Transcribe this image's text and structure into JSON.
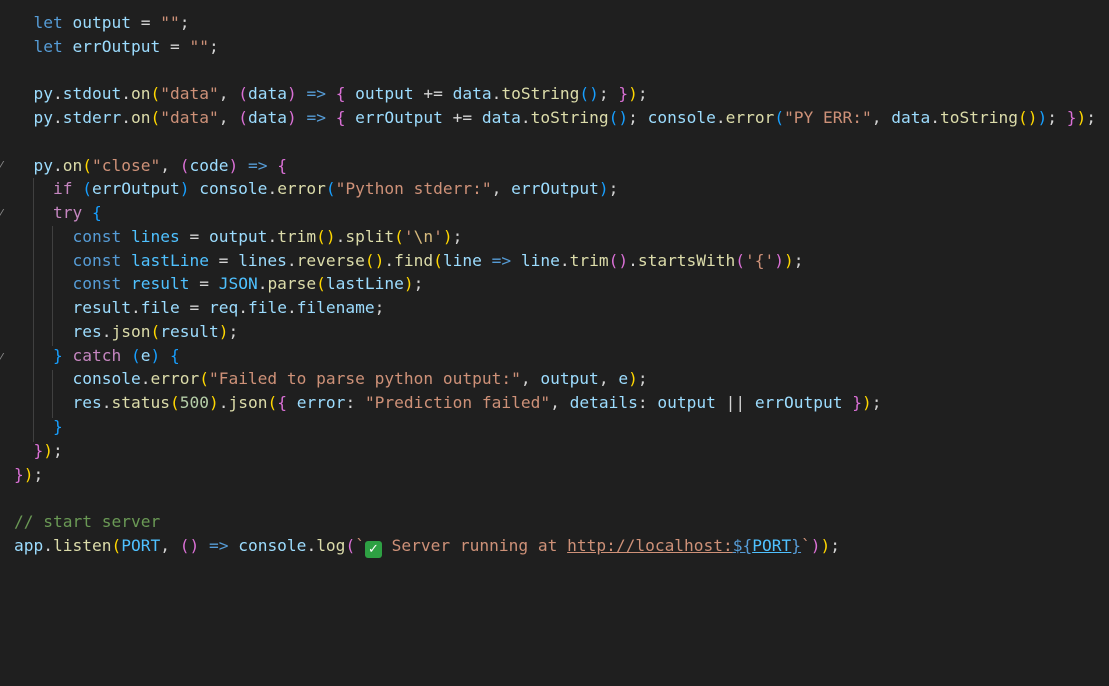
{
  "lines": {
    "l1": {
      "t1": "let",
      "t2": "output",
      "t3": "=",
      "t4": "\"\"",
      "t5": ";"
    },
    "l2": {
      "t1": "let",
      "t2": "errOutput",
      "t3": "=",
      "t4": "\"\"",
      "t5": ";"
    },
    "l4": {
      "t1": "py",
      "t2": ".",
      "t3": "stdout",
      "t4": ".",
      "t5": "on",
      "t6": "(",
      "t7": "\"data\"",
      "t8": ", ",
      "t9": "(",
      "t10": "data",
      "t11": ")",
      "t12": " => ",
      "t13": "{",
      "t14": " output ",
      "t15": "+=",
      "t16": " data",
      "t17": ".",
      "t18": "toString",
      "t19": "()",
      "t20": "; ",
      "t21": "}",
      "t22": ")",
      "t23": ";"
    },
    "l5": {
      "t1": "py",
      "t2": ".",
      "t3": "stderr",
      "t4": ".",
      "t5": "on",
      "t6": "(",
      "t7": "\"data\"",
      "t8": ", ",
      "t9": "(",
      "t10": "data",
      "t11": ")",
      "t12": " => ",
      "t13": "{",
      "t14": " errOutput ",
      "t15": "+=",
      "t16": " data",
      "t17": ".",
      "t18": "toString",
      "t19": "()",
      "t20": "; ",
      "t21": "console",
      "t22": ".",
      "t23": "error",
      "t24": "(",
      "t25": "\"PY ERR:\"",
      "t26": ", ",
      "t27": "data",
      "t28": ".",
      "t29": "toString",
      "t30": "()",
      "t31": ")",
      "t32": "; ",
      "t33": "}",
      "t34": ")",
      "t35": ";"
    },
    "l7": {
      "t1": "py",
      "t2": ".",
      "t3": "on",
      "t4": "(",
      "t5": "\"close\"",
      "t6": ", ",
      "t7": "(",
      "t8": "code",
      "t9": ")",
      "t10": " => ",
      "t11": "{"
    },
    "l8": {
      "t1": "if",
      "t2": " (",
      "t3": "errOutput",
      "t4": ") ",
      "t5": "console",
      "t6": ".",
      "t7": "error",
      "t8": "(",
      "t9": "\"Python stderr:\"",
      "t10": ", ",
      "t11": "errOutput",
      "t12": ")",
      "t13": ";"
    },
    "l9": {
      "t1": "try",
      "t2": " ",
      "t3": "{"
    },
    "l10": {
      "t1": "const",
      "t2": " ",
      "t3": "lines",
      "t4": " = ",
      "t5": "output",
      "t6": ".",
      "t7": "trim",
      "t8": "()",
      "t9": ".",
      "t10": "split",
      "t11": "(",
      "t12": "'",
      "t13": "\\n",
      "t14": "'",
      "t15": ")",
      "t16": ";"
    },
    "l11": {
      "t1": "const",
      "t2": " ",
      "t3": "lastLine",
      "t4": " = ",
      "t5": "lines",
      "t6": ".",
      "t7": "reverse",
      "t8": "()",
      "t9": ".",
      "t10": "find",
      "t11": "(",
      "t12": "line",
      "t13": " => ",
      "t14": "line",
      "t15": ".",
      "t16": "trim",
      "t17": "()",
      "t18": ".",
      "t19": "startsWith",
      "t20": "(",
      "t21": "'{'",
      "t22": ")",
      "t23": ")",
      "t24": ";"
    },
    "l12": {
      "t1": "const",
      "t2": " ",
      "t3": "result",
      "t4": " = ",
      "t5": "JSON",
      "t6": ".",
      "t7": "parse",
      "t8": "(",
      "t9": "lastLine",
      "t10": ")",
      "t11": ";"
    },
    "l13": {
      "t1": "result",
      "t2": ".",
      "t3": "file",
      "t4": " = ",
      "t5": "req",
      "t6": ".",
      "t7": "file",
      "t8": ".",
      "t9": "filename",
      "t10": ";"
    },
    "l14": {
      "t1": "res",
      "t2": ".",
      "t3": "json",
      "t4": "(",
      "t5": "result",
      "t6": ")",
      "t7": ";"
    },
    "l15": {
      "t1": "}",
      "t2": " ",
      "t3": "catch",
      "t4": " ",
      "t5": "(",
      "t6": "e",
      "t7": ")",
      "t8": " ",
      "t9": "{"
    },
    "l16": {
      "t1": "console",
      "t2": ".",
      "t3": "error",
      "t4": "(",
      "t5": "\"Failed to parse python output:\"",
      "t6": ", ",
      "t7": "output",
      "t8": ", ",
      "t9": "e",
      "t10": ")",
      "t11": ";"
    },
    "l17": {
      "t1": "res",
      "t2": ".",
      "t3": "status",
      "t4": "(",
      "t5": "500",
      "t6": ")",
      "t7": ".",
      "t8": "json",
      "t9": "(",
      "t10": "{",
      "t11": " error",
      "t12": ": ",
      "t13": "\"Prediction failed\"",
      "t14": ", ",
      "t15": "details",
      "t16": ": ",
      "t17": "output",
      "t18": " || ",
      "t19": "errOutput",
      "t20": " ",
      "t21": "}",
      "t22": ")",
      "t23": ";"
    },
    "l18": {
      "t1": "}"
    },
    "l19": {
      "t1": "}",
      "t2": ")",
      "t3": ";"
    },
    "l20": {
      "t1": "}",
      "t2": ")",
      "t3": ";"
    },
    "l22": {
      "t1": "// start server"
    },
    "l23": {
      "t1": "app",
      "t2": ".",
      "t3": "listen",
      "t4": "(",
      "t5": "PORT",
      "t6": ", ",
      "t7": "()",
      "t8": " => ",
      "t9": "console",
      "t10": ".",
      "t11": "log",
      "t12": "(",
      "t13": "`",
      "t14": "✓",
      "t15": " Server running at ",
      "t16": "http://localhost:",
      "t17": "${",
      "t18": "PORT",
      "t19": "}",
      "t20": "`",
      "t21": ")",
      "t22": ")",
      "t23": ";"
    }
  },
  "gutter": {
    "fold_marker": "⁄"
  }
}
